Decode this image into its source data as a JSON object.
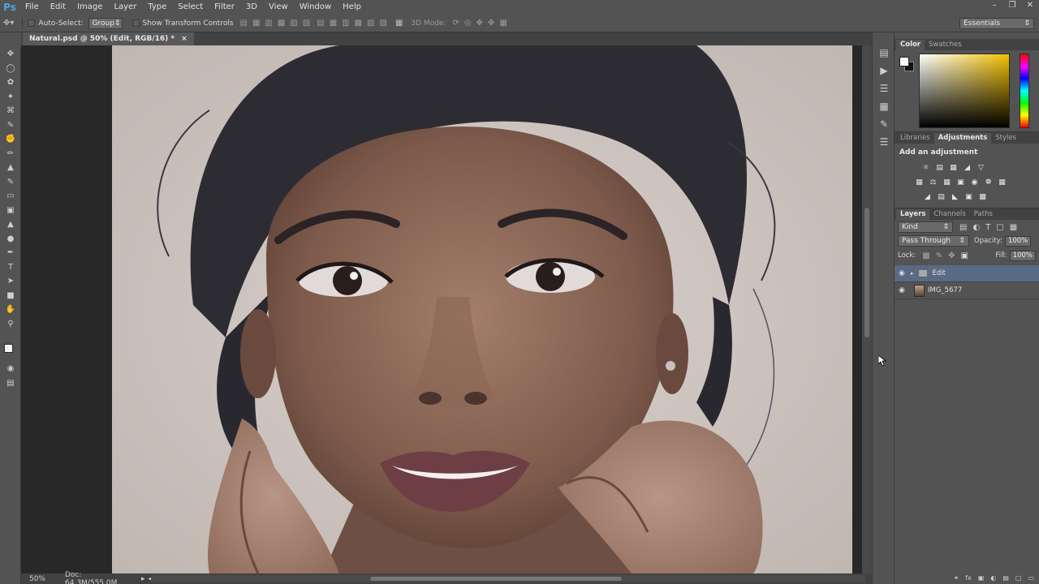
{
  "app": {
    "logo": "Ps",
    "menu": [
      "File",
      "Edit",
      "Image",
      "Layer",
      "Type",
      "Select",
      "Filter",
      "3D",
      "View",
      "Window",
      "Help"
    ],
    "window_controls": [
      "minimize",
      "restore",
      "close"
    ]
  },
  "options_bar": {
    "auto_select_label": "Auto-Select:",
    "auto_select_value": "Group",
    "show_transform_label": "Show Transform Controls",
    "mode_3d_label": "3D Mode:",
    "workspace": "Essentials"
  },
  "document": {
    "tab_title": "Natural.psd @ 50% (Edit, RGB/16) *",
    "zoom": "50%",
    "doc_size": "Doc: 64.3M/555.0M"
  },
  "tools": [
    "move-tool",
    "marquee-tool",
    "lasso-tool",
    "quick-select-tool",
    "crop-tool",
    "eyedropper-tool",
    "healing-brush-tool",
    "brush-tool",
    "clone-stamp-tool",
    "history-brush-tool",
    "eraser-tool",
    "gradient-tool",
    "blur-tool",
    "dodge-tool",
    "pen-tool",
    "type-tool",
    "path-selection-tool",
    "shape-tool",
    "hand-tool",
    "zoom-tool"
  ],
  "panels": {
    "color_tabs": [
      "Color",
      "Swatches"
    ],
    "adjustment_tabs": [
      "Libraries",
      "Adjustments",
      "Styles"
    ],
    "adjustments_title": "Add an adjustment",
    "layers_tabs": [
      "Layers",
      "Channels",
      "Paths"
    ],
    "filter_kind": "Kind",
    "blend_mode": "Pass Through",
    "opacity_label": "Opacity:",
    "opacity_value": "100%",
    "lock_label": "Lock:",
    "fill_label": "Fill:",
    "fill_value": "100%",
    "layers": [
      {
        "name": "Edit",
        "type": "group",
        "selected": true
      },
      {
        "name": "IMG_5677",
        "type": "image",
        "selected": false
      }
    ]
  }
}
